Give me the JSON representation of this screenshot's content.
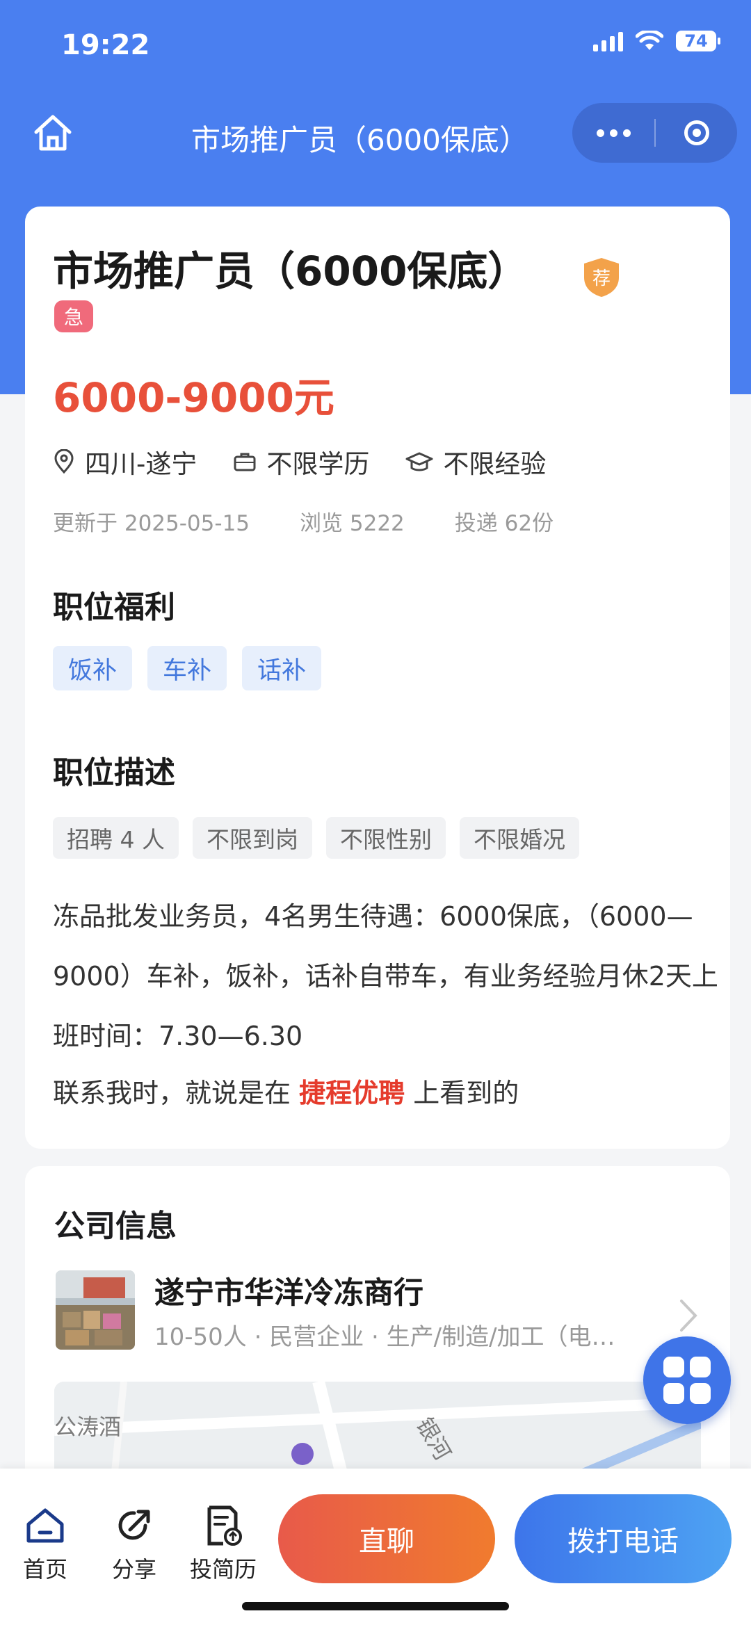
{
  "status_bar": {
    "time": "19:22",
    "battery": "74"
  },
  "nav": {
    "title": "市场推广员（6000保底）"
  },
  "job": {
    "title": "市场推广员（6000保底）",
    "badge": "荐",
    "urgent": "急",
    "salary": "6000-9000元",
    "location": "四川-遂宁",
    "education": "不限学历",
    "experience": "不限经验",
    "updated": "更新于 2025-05-15",
    "views": "浏览 5222",
    "applications": "投递 62份"
  },
  "benefits": {
    "title": "职位福利",
    "items": [
      "饭补",
      "车补",
      "话补"
    ]
  },
  "description": {
    "title": "职位描述",
    "tags": [
      "招聘 4 人",
      "不限到岗",
      "不限性别",
      "不限婚况"
    ],
    "text": "冻品批发业务员，4名男生待遇：6000保底，（6000—9000）车补，饭补，话补自带车，有业务经验月休2天上班时间：7.30—6.30",
    "contact_prefix": "联系我时，就说是在",
    "contact_brand": "捷程优聘",
    "contact_suffix": "上看到的"
  },
  "company": {
    "section_title": "公司信息",
    "name": "遂宁市华洋冷冻商行",
    "info": "10-50人 · 民营企业 · 生产/制造/加工（电…",
    "map_labels": [
      "公涛酒",
      "银河"
    ]
  },
  "bottom_bar": {
    "home": "首页",
    "share": "分享",
    "resume": "投简历",
    "chat": "直聊",
    "call": "拨打电话"
  },
  "colors": {
    "primary": "#4a7ff0",
    "salary": "#e8503a",
    "chat": "#f07b2e",
    "call": "#3d75ea"
  }
}
